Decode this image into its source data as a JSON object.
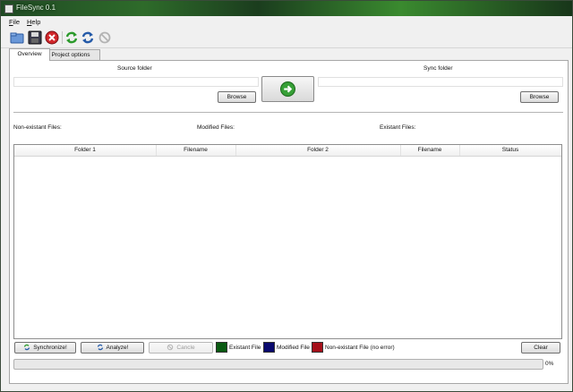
{
  "window": {
    "title": "FileSync 0.1"
  },
  "menu": [
    {
      "label": "File",
      "mnemonic": "F",
      "rest": "ile"
    },
    {
      "label": "Help",
      "mnemonic": "H",
      "rest": "elp"
    }
  ],
  "toolbar": {
    "icons": [
      "open-folder-icon",
      "save-disk-icon",
      "stop-red-icon",
      "refresh-green-icon",
      "refresh-blue-icon",
      "disabled-circle-icon"
    ]
  },
  "tabs": [
    {
      "label": "Overview",
      "active": true
    },
    {
      "label": "Project options",
      "active": false
    }
  ],
  "overview": {
    "source_label": "Source folder",
    "sync_label": "Sync folder",
    "browse_label": "Browse",
    "nonexistant_label": "Non-existant Files:",
    "modified_label": "Modified Files:",
    "existant_label": "Existant Files:"
  },
  "table": {
    "columns": [
      "Folder 1",
      "Filename",
      "Folder 2",
      "Filename",
      "Status"
    ],
    "rows": []
  },
  "bottom": {
    "synchronize_label": "Synchronize!",
    "analyze_label": "Analyze!",
    "cancel_label": "Cancle",
    "clear_label": "Clear",
    "legend": [
      {
        "label": "Existant File",
        "color": "#0a5a12"
      },
      {
        "label": "Modified File",
        "color": "#0a0a6e"
      },
      {
        "label": "Non-existant File (no error)",
        "color": "#a5101a"
      }
    ],
    "progress_text": "0%",
    "progress_value": 0
  },
  "colors": {
    "accent_green": "#3aa03a"
  }
}
